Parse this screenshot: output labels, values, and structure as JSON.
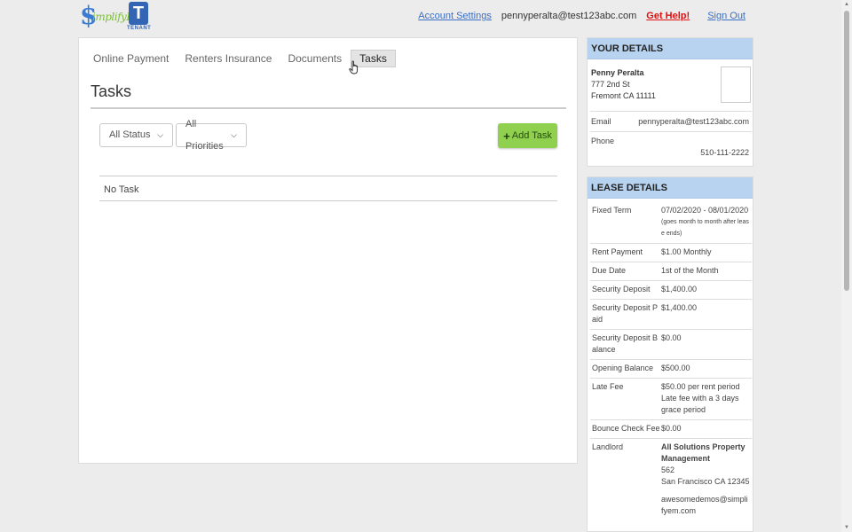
{
  "brand": {
    "logo_dollar": "$",
    "logo_text": "implifyEm",
    "logo_letter": "T",
    "logo_sub": "TENANT"
  },
  "top_nav": {
    "account_settings": "Account Settings",
    "user_email": "pennyperalta@test123abc.com",
    "get_help": "Get Help!",
    "sign_out": "Sign Out"
  },
  "tabs": [
    {
      "label": "Online Payment"
    },
    {
      "label": "Renters Insurance"
    },
    {
      "label": "Documents"
    },
    {
      "label": "Tasks"
    }
  ],
  "page_title": "Tasks",
  "filters": {
    "status": "All Status",
    "priority": "All Priorities"
  },
  "add_task_label": "Add Task",
  "task_list_empty": "No Task",
  "your_details": {
    "heading": "YOUR DETAILS",
    "name": "Penny Peralta",
    "address_line1": "777 2nd St",
    "address_line2": "Fremont CA 11111",
    "email_label": "Email",
    "email_value": "pennyperalta@test123abc.com",
    "phone_label": "Phone",
    "phone_value": "510-111-2222"
  },
  "lease_details": {
    "heading": "LEASE DETAILS",
    "fixed_term_label": "Fixed Term",
    "fixed_term_value": "07/02/2020 - 08/01/2020",
    "fixed_term_note": "(goes month to month after lease ends)",
    "rent_payment_label": "Rent Payment",
    "rent_payment_value": "$1.00 Monthly",
    "due_date_label": "Due Date",
    "due_date_value": "1st of the Month",
    "security_deposit_label": "Security Deposit",
    "security_deposit_value": "$1,400.00",
    "security_deposit_paid_label": "Security Deposit Paid",
    "security_deposit_paid_value": "$1,400.00",
    "security_deposit_balance_label": "Security Deposit Balance",
    "security_deposit_balance_value": "$0.00",
    "opening_balance_label": "Opening Balance",
    "opening_balance_value": "$500.00",
    "late_fee_label": "Late Fee",
    "late_fee_value": "$50.00 per rent period",
    "late_fee_note": "Late fee with a 3 days grace period",
    "bounce_check_fee_label": "Bounce Check Fee",
    "bounce_check_fee_value": "$0.00",
    "landlord_label": "Landlord",
    "landlord_name": "All Solutions Property Management",
    "landlord_address1": "562",
    "landlord_address2": "San Francisco CA 12345",
    "landlord_email": "awesomedemos@simplifyem.com"
  },
  "colors": {
    "accent_blue": "#3a6fc4",
    "help_red": "#e01010",
    "add_button_green": "#8fd14f",
    "card_header_blue": "#b7d3ef"
  }
}
